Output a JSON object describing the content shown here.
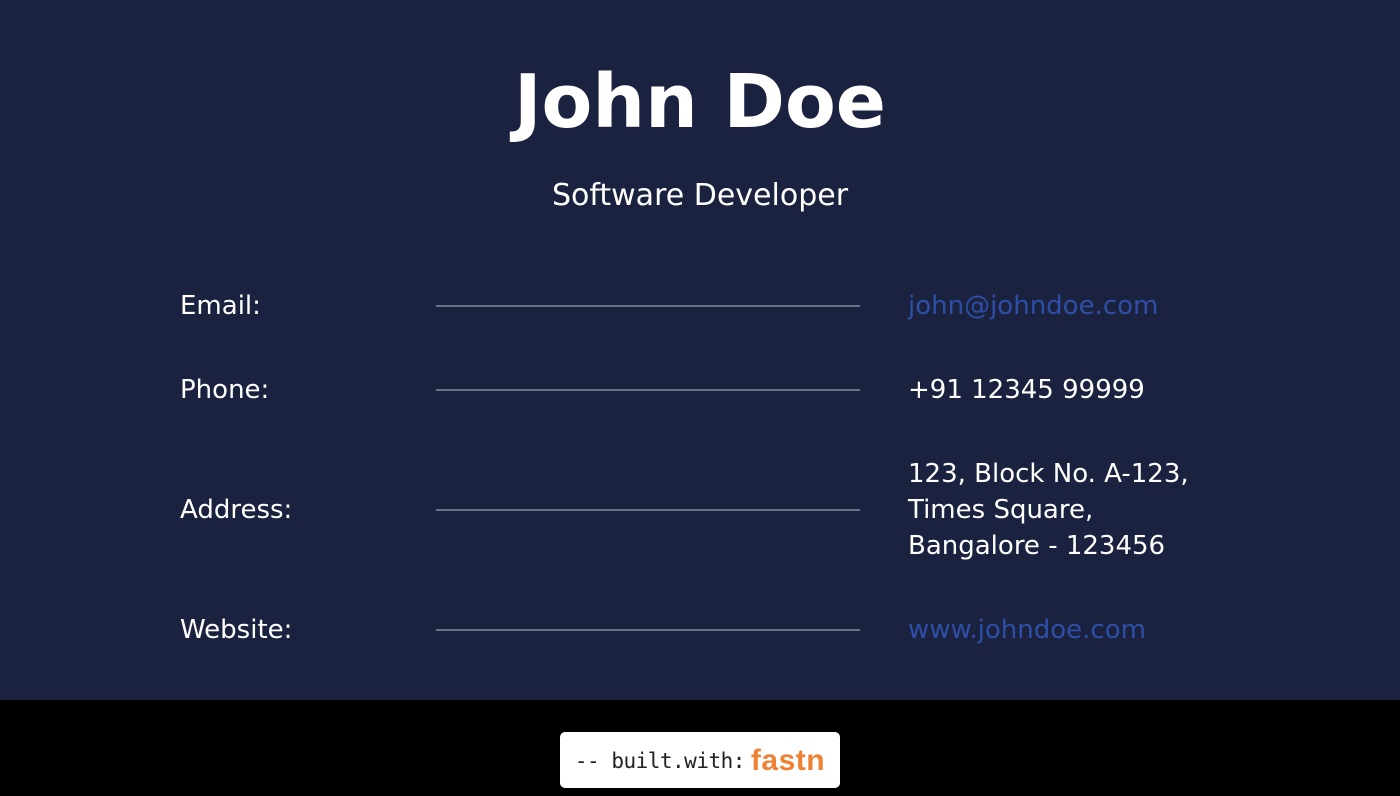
{
  "header": {
    "name": "John Doe",
    "role": "Software Developer"
  },
  "contact": {
    "email": {
      "label": "Email:",
      "value": "john@johndoe.com"
    },
    "phone": {
      "label": "Phone:",
      "value": "+91 12345 99999"
    },
    "address": {
      "label": "Address:",
      "lines": [
        "123, Block No. A-123,",
        "Times Square,",
        "Bangalore - 123456"
      ]
    },
    "website": {
      "label": "Website:",
      "value": "www.johndoe.com"
    }
  },
  "footer": {
    "badge_prefix": "-- built.with:",
    "badge_brand": "fastn"
  },
  "colors": {
    "background": "#1b2240",
    "link": "#2e4fa6",
    "rule": "#6b7388",
    "footer_background": "#000000",
    "brand": "#ef8135"
  }
}
